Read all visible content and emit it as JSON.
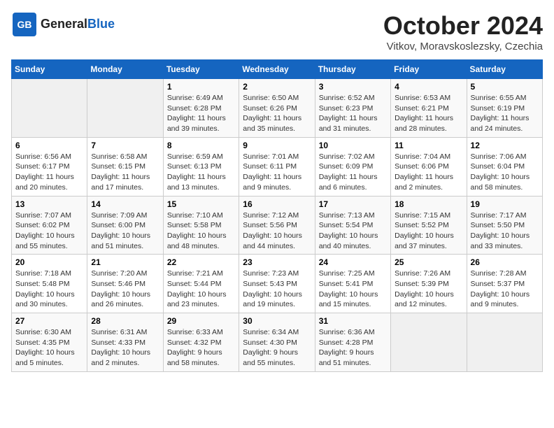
{
  "header": {
    "logo_line1": "General",
    "logo_line2": "Blue",
    "month": "October 2024",
    "location": "Vitkov, Moravskoslezsky, Czechia"
  },
  "days_of_week": [
    "Sunday",
    "Monday",
    "Tuesday",
    "Wednesday",
    "Thursday",
    "Friday",
    "Saturday"
  ],
  "weeks": [
    [
      {
        "day": "",
        "data": ""
      },
      {
        "day": "",
        "data": ""
      },
      {
        "day": "1",
        "data": "Sunrise: 6:49 AM\nSunset: 6:28 PM\nDaylight: 11 hours and 39 minutes."
      },
      {
        "day": "2",
        "data": "Sunrise: 6:50 AM\nSunset: 6:26 PM\nDaylight: 11 hours and 35 minutes."
      },
      {
        "day": "3",
        "data": "Sunrise: 6:52 AM\nSunset: 6:23 PM\nDaylight: 11 hours and 31 minutes."
      },
      {
        "day": "4",
        "data": "Sunrise: 6:53 AM\nSunset: 6:21 PM\nDaylight: 11 hours and 28 minutes."
      },
      {
        "day": "5",
        "data": "Sunrise: 6:55 AM\nSunset: 6:19 PM\nDaylight: 11 hours and 24 minutes."
      }
    ],
    [
      {
        "day": "6",
        "data": "Sunrise: 6:56 AM\nSunset: 6:17 PM\nDaylight: 11 hours and 20 minutes."
      },
      {
        "day": "7",
        "data": "Sunrise: 6:58 AM\nSunset: 6:15 PM\nDaylight: 11 hours and 17 minutes."
      },
      {
        "day": "8",
        "data": "Sunrise: 6:59 AM\nSunset: 6:13 PM\nDaylight: 11 hours and 13 minutes."
      },
      {
        "day": "9",
        "data": "Sunrise: 7:01 AM\nSunset: 6:11 PM\nDaylight: 11 hours and 9 minutes."
      },
      {
        "day": "10",
        "data": "Sunrise: 7:02 AM\nSunset: 6:09 PM\nDaylight: 11 hours and 6 minutes."
      },
      {
        "day": "11",
        "data": "Sunrise: 7:04 AM\nSunset: 6:06 PM\nDaylight: 11 hours and 2 minutes."
      },
      {
        "day": "12",
        "data": "Sunrise: 7:06 AM\nSunset: 6:04 PM\nDaylight: 10 hours and 58 minutes."
      }
    ],
    [
      {
        "day": "13",
        "data": "Sunrise: 7:07 AM\nSunset: 6:02 PM\nDaylight: 10 hours and 55 minutes."
      },
      {
        "day": "14",
        "data": "Sunrise: 7:09 AM\nSunset: 6:00 PM\nDaylight: 10 hours and 51 minutes."
      },
      {
        "day": "15",
        "data": "Sunrise: 7:10 AM\nSunset: 5:58 PM\nDaylight: 10 hours and 48 minutes."
      },
      {
        "day": "16",
        "data": "Sunrise: 7:12 AM\nSunset: 5:56 PM\nDaylight: 10 hours and 44 minutes."
      },
      {
        "day": "17",
        "data": "Sunrise: 7:13 AM\nSunset: 5:54 PM\nDaylight: 10 hours and 40 minutes."
      },
      {
        "day": "18",
        "data": "Sunrise: 7:15 AM\nSunset: 5:52 PM\nDaylight: 10 hours and 37 minutes."
      },
      {
        "day": "19",
        "data": "Sunrise: 7:17 AM\nSunset: 5:50 PM\nDaylight: 10 hours and 33 minutes."
      }
    ],
    [
      {
        "day": "20",
        "data": "Sunrise: 7:18 AM\nSunset: 5:48 PM\nDaylight: 10 hours and 30 minutes."
      },
      {
        "day": "21",
        "data": "Sunrise: 7:20 AM\nSunset: 5:46 PM\nDaylight: 10 hours and 26 minutes."
      },
      {
        "day": "22",
        "data": "Sunrise: 7:21 AM\nSunset: 5:44 PM\nDaylight: 10 hours and 23 minutes."
      },
      {
        "day": "23",
        "data": "Sunrise: 7:23 AM\nSunset: 5:43 PM\nDaylight: 10 hours and 19 minutes."
      },
      {
        "day": "24",
        "data": "Sunrise: 7:25 AM\nSunset: 5:41 PM\nDaylight: 10 hours and 15 minutes."
      },
      {
        "day": "25",
        "data": "Sunrise: 7:26 AM\nSunset: 5:39 PM\nDaylight: 10 hours and 12 minutes."
      },
      {
        "day": "26",
        "data": "Sunrise: 7:28 AM\nSunset: 5:37 PM\nDaylight: 10 hours and 9 minutes."
      }
    ],
    [
      {
        "day": "27",
        "data": "Sunrise: 6:30 AM\nSunset: 4:35 PM\nDaylight: 10 hours and 5 minutes."
      },
      {
        "day": "28",
        "data": "Sunrise: 6:31 AM\nSunset: 4:33 PM\nDaylight: 10 hours and 2 minutes."
      },
      {
        "day": "29",
        "data": "Sunrise: 6:33 AM\nSunset: 4:32 PM\nDaylight: 9 hours and 58 minutes."
      },
      {
        "day": "30",
        "data": "Sunrise: 6:34 AM\nSunset: 4:30 PM\nDaylight: 9 hours and 55 minutes."
      },
      {
        "day": "31",
        "data": "Sunrise: 6:36 AM\nSunset: 4:28 PM\nDaylight: 9 hours and 51 minutes."
      },
      {
        "day": "",
        "data": ""
      },
      {
        "day": "",
        "data": ""
      }
    ]
  ]
}
